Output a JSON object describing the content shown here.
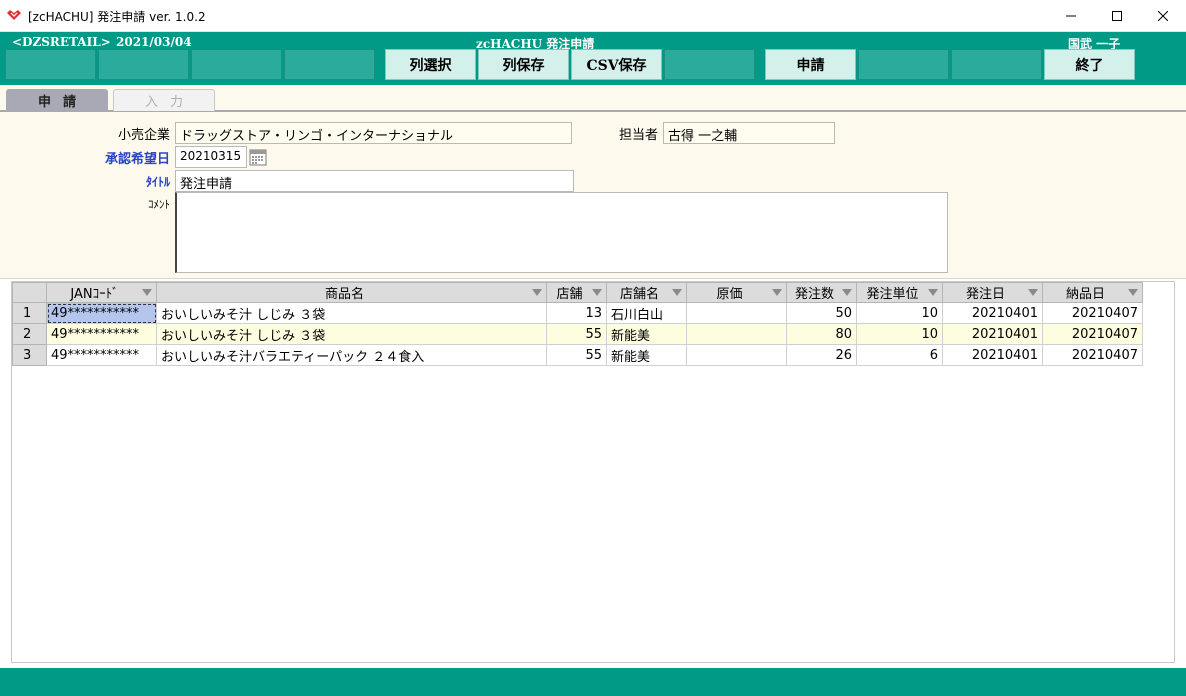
{
  "window": {
    "title": "[zcHACHU] 発注申請 ver. 1.0.2"
  },
  "header": {
    "company": "<DZSRETAIL>",
    "date": "2021/03/04",
    "app_title": "zcHACHU  発注申請",
    "user": "国武  一子",
    "buttons": {
      "col_select": "列選択",
      "col_save": "列保存",
      "csv_save": "CSV保存",
      "apply": "申請",
      "exit": "終了"
    }
  },
  "tabs": {
    "apply": "申請",
    "input": "入力"
  },
  "form": {
    "retailer_label": "小売企業",
    "retailer_value": "ドラッグストア・リンゴ・インターナショナル",
    "person_label": "担当者",
    "person_value": "古得  一之輔",
    "date_label": "承認希望日",
    "date_value": "20210315",
    "title_label": "ﾀｲﾄﾙ",
    "title_value": "発注申請",
    "comment_label": "ｺﾒﾝﾄ",
    "comment_value": ""
  },
  "grid": {
    "columns": {
      "jan": "JANｺｰﾄﾞ",
      "product": "商品名",
      "store": "店舗",
      "store_name": "店舗名",
      "cost": "原価",
      "qty": "発注数",
      "unit": "発注単位",
      "order_date": "発注日",
      "delivery_date": "納品日"
    },
    "rows": [
      {
        "no": "1",
        "jan": "49***********",
        "product": "おいしいみそ汁  しじみ  ３袋",
        "store": "13",
        "store_name": "石川白山",
        "cost": "",
        "qty": "50",
        "unit": "10",
        "order_date": "20210401",
        "delivery_date": "20210407"
      },
      {
        "no": "2",
        "jan": "49***********",
        "product": "おいしいみそ汁  しじみ  ３袋",
        "store": "55",
        "store_name": "新能美",
        "cost": "",
        "qty": "80",
        "unit": "10",
        "order_date": "20210401",
        "delivery_date": "20210407"
      },
      {
        "no": "3",
        "jan": "49***********",
        "product": "おいしいみそ汁バラエティーパック  ２４食入",
        "store": "55",
        "store_name": "新能美",
        "cost": "",
        "qty": "26",
        "unit": "6",
        "order_date": "20210401",
        "delivery_date": "20210407"
      }
    ]
  },
  "colors": {
    "teal": "#009a87",
    "button_active": "#d3f0ea",
    "form_bg": "#fdf9ec",
    "label_blue": "#2b44c6"
  }
}
